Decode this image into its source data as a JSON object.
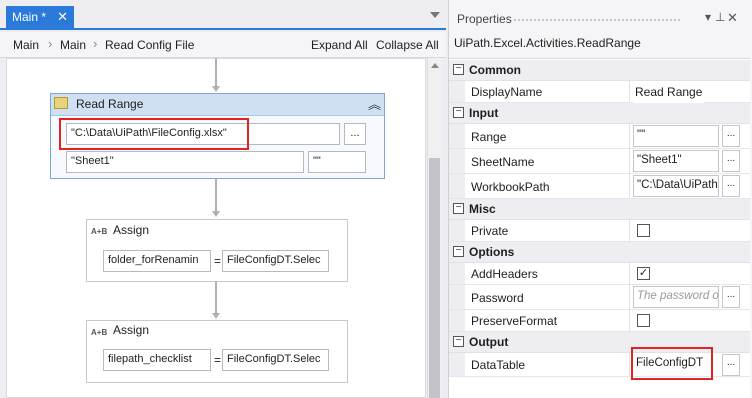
{
  "tab": {
    "label": "Main *",
    "close": "✕"
  },
  "breadcrumb": [
    "Main",
    "Main",
    "Read Config File"
  ],
  "toolbar": {
    "expand_all": "Expand All",
    "collapse_all": "Collapse All"
  },
  "workflow": {
    "read_range": {
      "title": "Read Range",
      "workbook_path": "\"C:\\Data\\UiPath\\FileConfig.xlsx\"",
      "sheet": "\"Sheet1\"",
      "range": "\"\"",
      "ellipsis": "..."
    },
    "assign1": {
      "title": "Assign",
      "left": "folder_forRenamin",
      "op": "=",
      "right": "FileConfigDT.Selec"
    },
    "assign2": {
      "title": "Assign",
      "left": "filepath_checklist",
      "op": "=",
      "right": "FileConfigDT.Selec"
    },
    "icon_text": "A+B"
  },
  "properties": {
    "title": "Properties",
    "class_name": "UiPath.Excel.Activities.ReadRange",
    "categories": {
      "common": "Common",
      "input": "Input",
      "misc": "Misc",
      "options": "Options",
      "output": "Output"
    },
    "rows": {
      "display_name": {
        "name": "DisplayName",
        "value": "Read Range"
      },
      "range": {
        "name": "Range",
        "value": "\"\""
      },
      "sheet_name": {
        "name": "SheetName",
        "value": "\"Sheet1\""
      },
      "workbook_path": {
        "name": "WorkbookPath",
        "value": "\"C:\\Data\\UiPath"
      },
      "private": {
        "name": "Private",
        "checked": false
      },
      "add_headers": {
        "name": "AddHeaders",
        "checked": true
      },
      "password": {
        "name": "Password",
        "placeholder": "The password o"
      },
      "preserve_format": {
        "name": "PreserveFormat",
        "checked": false
      },
      "data_table": {
        "name": "DataTable",
        "value": "FileConfigDT"
      }
    },
    "toggle": "−",
    "ellipsis": "...",
    "check_mark": "✓"
  },
  "colors": {
    "accent": "#2b79d8",
    "highlight": "#e02323"
  }
}
